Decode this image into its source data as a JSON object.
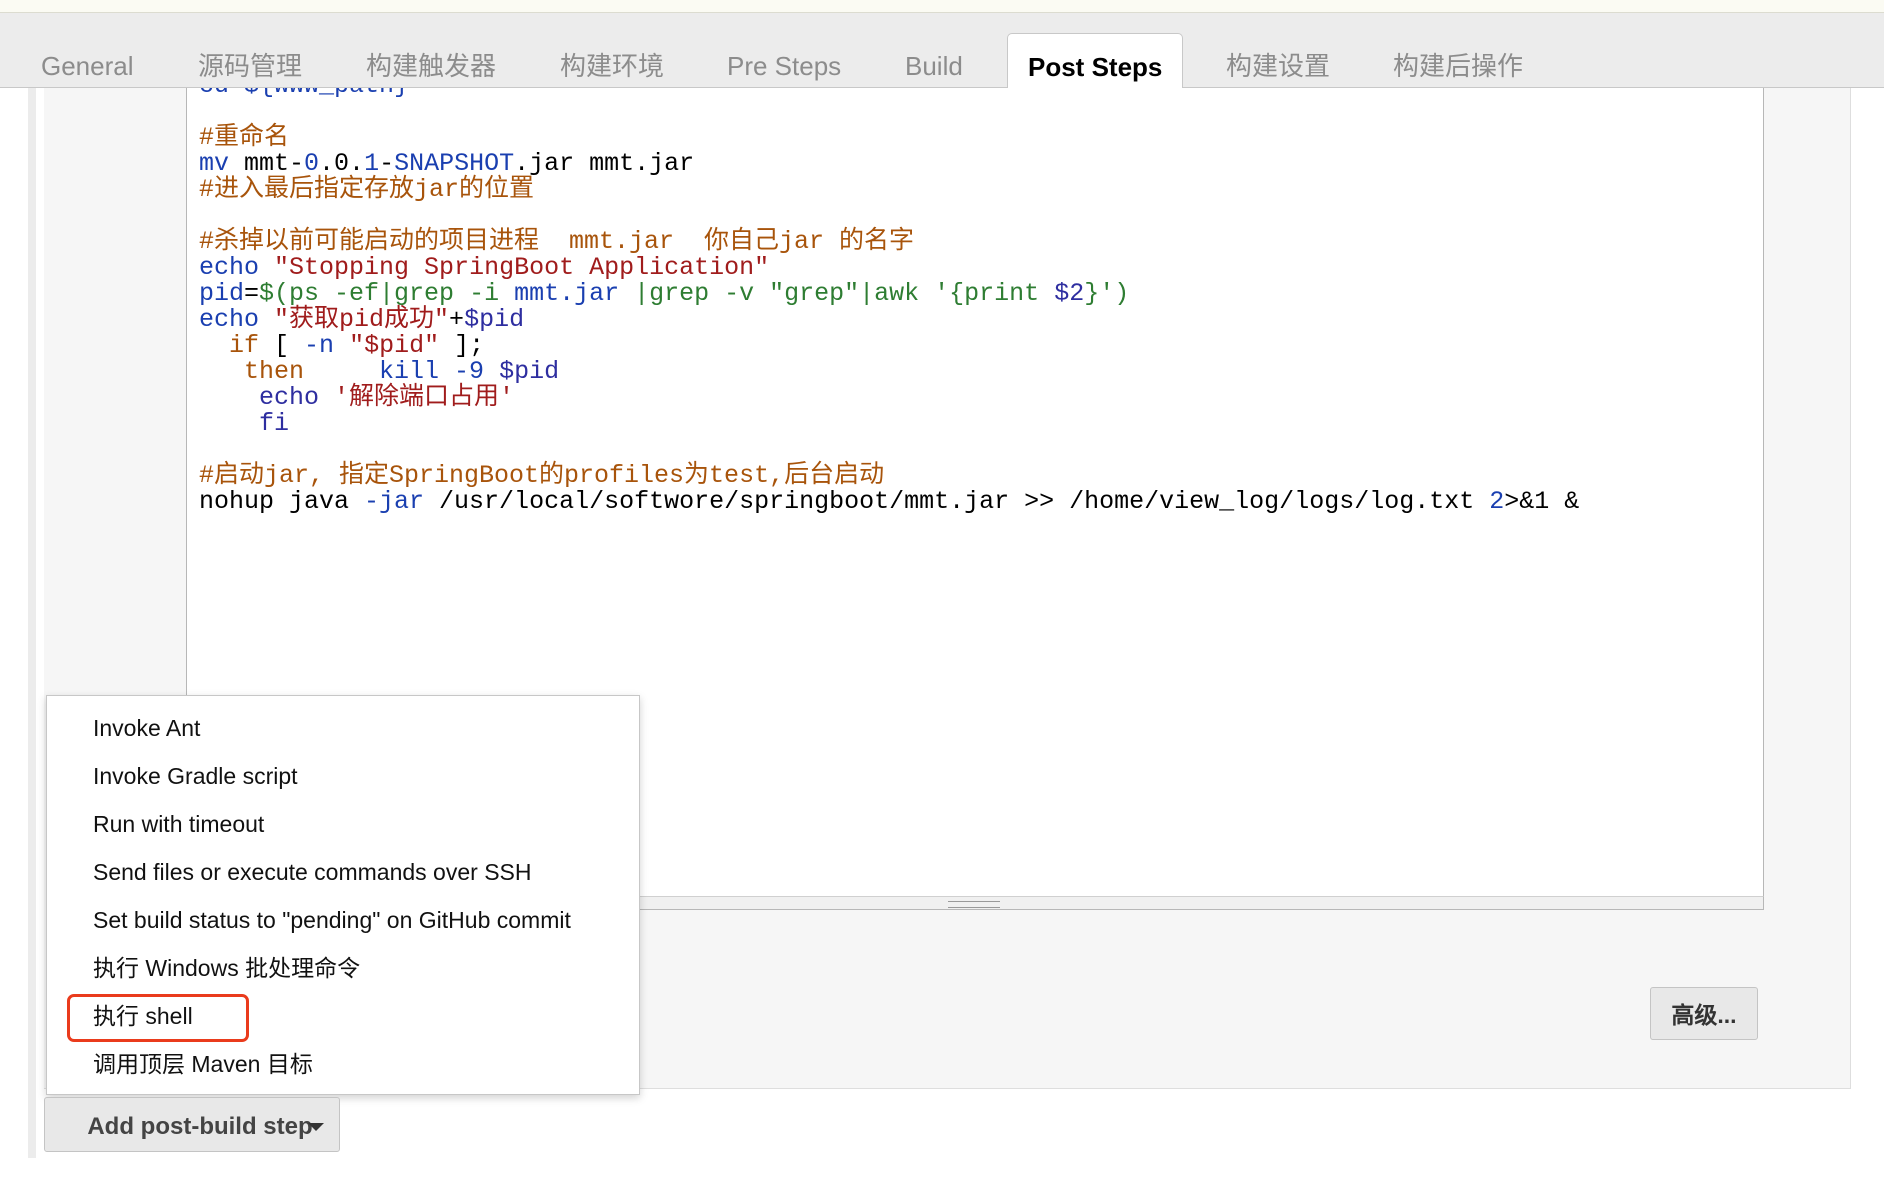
{
  "tabs": [
    {
      "label": "General"
    },
    {
      "label": "源码管理"
    },
    {
      "label": "构建触发器"
    },
    {
      "label": "构建环境"
    },
    {
      "label": "Pre Steps"
    },
    {
      "label": "Build"
    },
    {
      "label": "Post Steps"
    },
    {
      "label": "构建设置"
    },
    {
      "label": "构建后操作"
    }
  ],
  "active_tab": "Post Steps",
  "editor": {
    "lines": [
      {
        "tokens": [
          {
            "t": "cd ${www_path}",
            "c": "k"
          }
        ]
      },
      {
        "tokens": []
      },
      {
        "tokens": [
          {
            "t": "#重命名",
            "c": "c"
          }
        ]
      },
      {
        "tokens": [
          {
            "t": "mv",
            "c": "k"
          },
          {
            "t": " mmt-",
            "c": ""
          },
          {
            "t": "0",
            "c": "k"
          },
          {
            "t": ".0.",
            "c": ""
          },
          {
            "t": "1",
            "c": "k"
          },
          {
            "t": "-",
            "c": ""
          },
          {
            "t": "SNAPSHOT",
            "c": "k"
          },
          {
            "t": ".jar mmt.jar",
            "c": ""
          }
        ]
      },
      {
        "tokens": [
          {
            "t": "#进入最后指定存放jar的位置",
            "c": "c"
          }
        ]
      },
      {
        "tokens": []
      },
      {
        "tokens": [
          {
            "t": "#杀掉以前可能启动的项目进程  mmt.jar  你自己jar 的名字",
            "c": "c"
          }
        ]
      },
      {
        "tokens": [
          {
            "t": "echo",
            "c": "k"
          },
          {
            "t": " ",
            "c": ""
          },
          {
            "t": "\"Stopping SpringBoot Application\"",
            "c": "s"
          }
        ]
      },
      {
        "tokens": [
          {
            "t": "pid",
            "c": "k"
          },
          {
            "t": "=",
            "c": ""
          },
          {
            "t": "$(ps -ef|grep -i ",
            "c": "g"
          },
          {
            "t": "mmt.jar",
            "c": "k"
          },
          {
            "t": " |grep -v ",
            "c": "g"
          },
          {
            "t": "\"grep\"",
            "c": "g"
          },
          {
            "t": "|awk ",
            "c": "g"
          },
          {
            "t": "'{print ",
            "c": "g"
          },
          {
            "t": "$2",
            "c": "v"
          },
          {
            "t": "}')",
            "c": "g"
          }
        ]
      },
      {
        "tokens": [
          {
            "t": "echo",
            "c": "k"
          },
          {
            "t": " ",
            "c": ""
          },
          {
            "t": "\"获取pid成功\"",
            "c": "s"
          },
          {
            "t": "+",
            "c": ""
          },
          {
            "t": "$pid",
            "c": "v"
          }
        ]
      },
      {
        "tokens": [
          {
            "t": "  ",
            "c": ""
          },
          {
            "t": "if",
            "c": "c"
          },
          {
            "t": " [ ",
            "c": ""
          },
          {
            "t": "-n",
            "c": "k"
          },
          {
            "t": " ",
            "c": ""
          },
          {
            "t": "\"$pid\"",
            "c": "s"
          },
          {
            "t": " ];",
            "c": ""
          }
        ]
      },
      {
        "tokens": [
          {
            "t": "   ",
            "c": ""
          },
          {
            "t": "then",
            "c": "c"
          },
          {
            "t": "     ",
            "c": ""
          },
          {
            "t": "kill -9",
            "c": "k"
          },
          {
            "t": " ",
            "c": ""
          },
          {
            "t": "$pid",
            "c": "v"
          }
        ]
      },
      {
        "tokens": [
          {
            "t": "    ",
            "c": ""
          },
          {
            "t": "echo",
            "c": "v"
          },
          {
            "t": " ",
            "c": ""
          },
          {
            "t": "'解除端口占用'",
            "c": "s"
          }
        ]
      },
      {
        "tokens": [
          {
            "t": "    ",
            "c": ""
          },
          {
            "t": "fi",
            "c": "v"
          }
        ]
      },
      {
        "tokens": []
      },
      {
        "tokens": [
          {
            "t": "#启动jar, 指定SpringBoot的profiles为test,后台启动",
            "c": "c"
          }
        ]
      },
      {
        "tokens": [
          {
            "t": "nohup java ",
            "c": ""
          },
          {
            "t": "-jar",
            "c": "k"
          },
          {
            "t": " /usr/local/softwore/springboot/mmt.jar >> /home/view_log/logs/log.txt ",
            "c": ""
          },
          {
            "t": "2",
            "c": "k"
          },
          {
            "t": ">&1 &",
            "c": ""
          }
        ]
      }
    ]
  },
  "dropdown": {
    "items": [
      {
        "label": "Invoke Ant"
      },
      {
        "label": "Invoke Gradle script"
      },
      {
        "label": "Run with timeout"
      },
      {
        "label": "Send files or execute commands over SSH"
      },
      {
        "label": "Set build status to \"pending\" on GitHub commit"
      },
      {
        "label": "执行 Windows 批处理命令"
      },
      {
        "label": "执行 shell"
      },
      {
        "label": "调用顶层 Maven 目标"
      }
    ],
    "highlighted_item": "执行 shell",
    "highlight_color": "#ea3b1c"
  },
  "advanced_button": {
    "label": "高级..."
  },
  "add_step_button": {
    "label": "Add post-build step",
    "icon": "caret-down-icon"
  }
}
